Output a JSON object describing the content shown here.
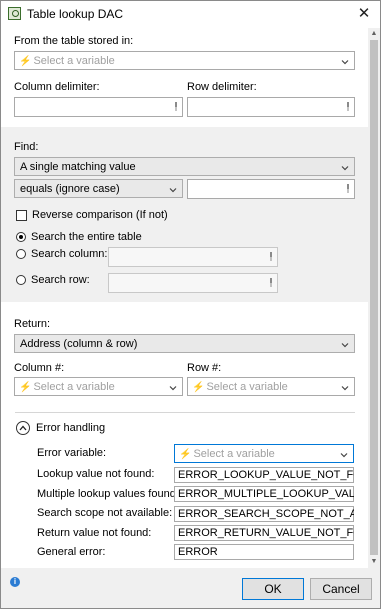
{
  "window": {
    "title": "Table lookup DAC",
    "close_label": "✕"
  },
  "source": {
    "label": "From the table stored in:",
    "placeholder": "Select a variable"
  },
  "delimiters": {
    "column_label": "Column delimiter:",
    "row_label": "Row delimiter:",
    "column_value": "",
    "row_value": ""
  },
  "find": {
    "label": "Find:",
    "mode_value": "A single matching value",
    "comparison_value": "equals (ignore case)",
    "comparison_input": "",
    "reverse_label": "Reverse comparison (If not)",
    "reverse_checked": false,
    "scope_options": [
      {
        "label": "Search the entire table",
        "selected": true
      },
      {
        "label": "Search column:",
        "selected": false
      },
      {
        "label": "Search row:",
        "selected": false
      }
    ]
  },
  "return": {
    "label": "Return:",
    "value": "Address (column & row)",
    "column_label": "Column #:",
    "row_label": "Row #:",
    "column_placeholder": "Select a variable",
    "row_placeholder": "Select a variable"
  },
  "error_handling": {
    "label": "Error handling",
    "variable_label": "Error variable:",
    "variable_placeholder": "Select a variable",
    "rows": [
      {
        "label": "Lookup value not found:",
        "value": "ERROR_LOOKUP_VALUE_NOT_FOUND"
      },
      {
        "label": "Multiple lookup values found:",
        "value": "ERROR_MULTIPLE_LOOKUP_VALUES_FO"
      },
      {
        "label": "Search scope not available:",
        "value": "ERROR_SEARCH_SCOPE_NOT_AVAILABL"
      },
      {
        "label": "Return value not found:",
        "value": "ERROR_RETURN_VALUE_NOT_FOUND"
      },
      {
        "label": "General error:",
        "value": "ERROR"
      }
    ]
  },
  "footer": {
    "ok_label": "OK",
    "cancel_label": "Cancel",
    "info_glyph": "i"
  },
  "icons": {
    "variable": "bolt-icon",
    "pin": "pin-icon",
    "dropdown": "chevron-down-icon"
  },
  "colors": {
    "accent": "#0078d7",
    "variable_icon": "#4a7bd0",
    "section_bg": "#f0f0f0"
  }
}
